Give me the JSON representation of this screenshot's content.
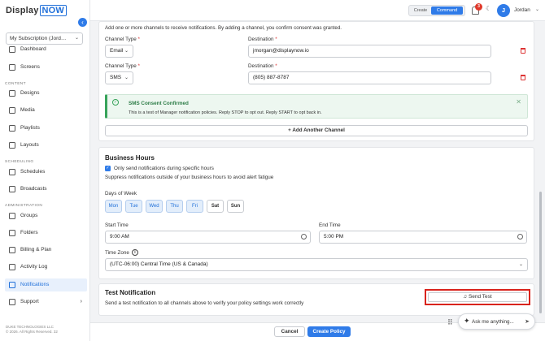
{
  "app": {
    "logo_display": "Display",
    "logo_now": "NOW",
    "subscription": "My Subscription (Jord…",
    "copyright_line1": "DUKE TECHNOLOGIES LLC",
    "copyright_line2": "© 2026. All Rights Reserved. 32"
  },
  "sidebar": {
    "items": [
      {
        "label": "Dashboard",
        "icon": "dashboard-icon"
      },
      {
        "label": "Screens",
        "icon": "screen-icon"
      },
      {
        "label": "Designs",
        "icon": "design-icon"
      },
      {
        "label": "Media",
        "icon": "media-icon"
      },
      {
        "label": "Playlists",
        "icon": "playlist-icon"
      },
      {
        "label": "Layouts",
        "icon": "layout-icon"
      },
      {
        "label": "Schedules",
        "icon": "calendar-icon"
      },
      {
        "label": "Broadcasts",
        "icon": "broadcast-icon"
      },
      {
        "label": "Groups",
        "icon": "groups-icon"
      },
      {
        "label": "Folders",
        "icon": "folder-icon"
      },
      {
        "label": "Billing & Plan",
        "icon": "billing-icon"
      },
      {
        "label": "Activity Log",
        "icon": "log-icon"
      },
      {
        "label": "Notifications",
        "icon": "bell-icon"
      },
      {
        "label": "Support",
        "icon": "support-icon"
      }
    ],
    "sections": {
      "content": "CONTENT",
      "scheduling": "SCHEDULING",
      "administration": "ADMINISTRATION"
    }
  },
  "topbar": {
    "mode_create": "Create",
    "mode_command": "Command",
    "notification_count": "3",
    "avatar_initial": "J",
    "user_name": "Jordan"
  },
  "channels": {
    "intro": "Add one or more channels to receive notifications. By adding a channel, you confirm consent was granted.",
    "type_label": "Channel Type",
    "destination_label": "Destination",
    "required_mark": "*",
    "rows": [
      {
        "type": "Email",
        "destination": "jmorgan@displaynow.io"
      },
      {
        "type": "SMS",
        "destination": "(805) 887-8787"
      }
    ],
    "consent_title": "SMS Consent Confirmed",
    "consent_message": "This is a test of Manager notification policies. Reply STOP to opt out. Reply START to opt back in.",
    "add_button": "+ Add Another Channel"
  },
  "business_hours": {
    "title": "Business Hours",
    "checkbox_label": "Only send notifications during specific hours",
    "checkbox_checked": true,
    "hint": "Suppress notifications outside of your business hours to avoid alert fatigue",
    "days_label": "Days of Week",
    "days": [
      {
        "label": "Mon",
        "selected": true
      },
      {
        "label": "Tue",
        "selected": true
      },
      {
        "label": "Wed",
        "selected": true
      },
      {
        "label": "Thu",
        "selected": true
      },
      {
        "label": "Fri",
        "selected": true
      },
      {
        "label": "Sat",
        "selected": false
      },
      {
        "label": "Sun",
        "selected": false
      }
    ],
    "start_label": "Start Time",
    "start_value": "9:00 AM",
    "end_label": "End Time",
    "end_value": "5:00 PM",
    "timezone_label": "Time Zone",
    "timezone_value": "(UTC-06:00) Central Time (US & Canada)"
  },
  "test_notification": {
    "title": "Test Notification",
    "description": "Send a test notification to all channels above to verify your policy settings work correctly",
    "button": "Send Test"
  },
  "footer": {
    "cancel": "Cancel",
    "create": "Create Policy"
  },
  "assistant": {
    "placeholder": "Ask me anything..."
  }
}
